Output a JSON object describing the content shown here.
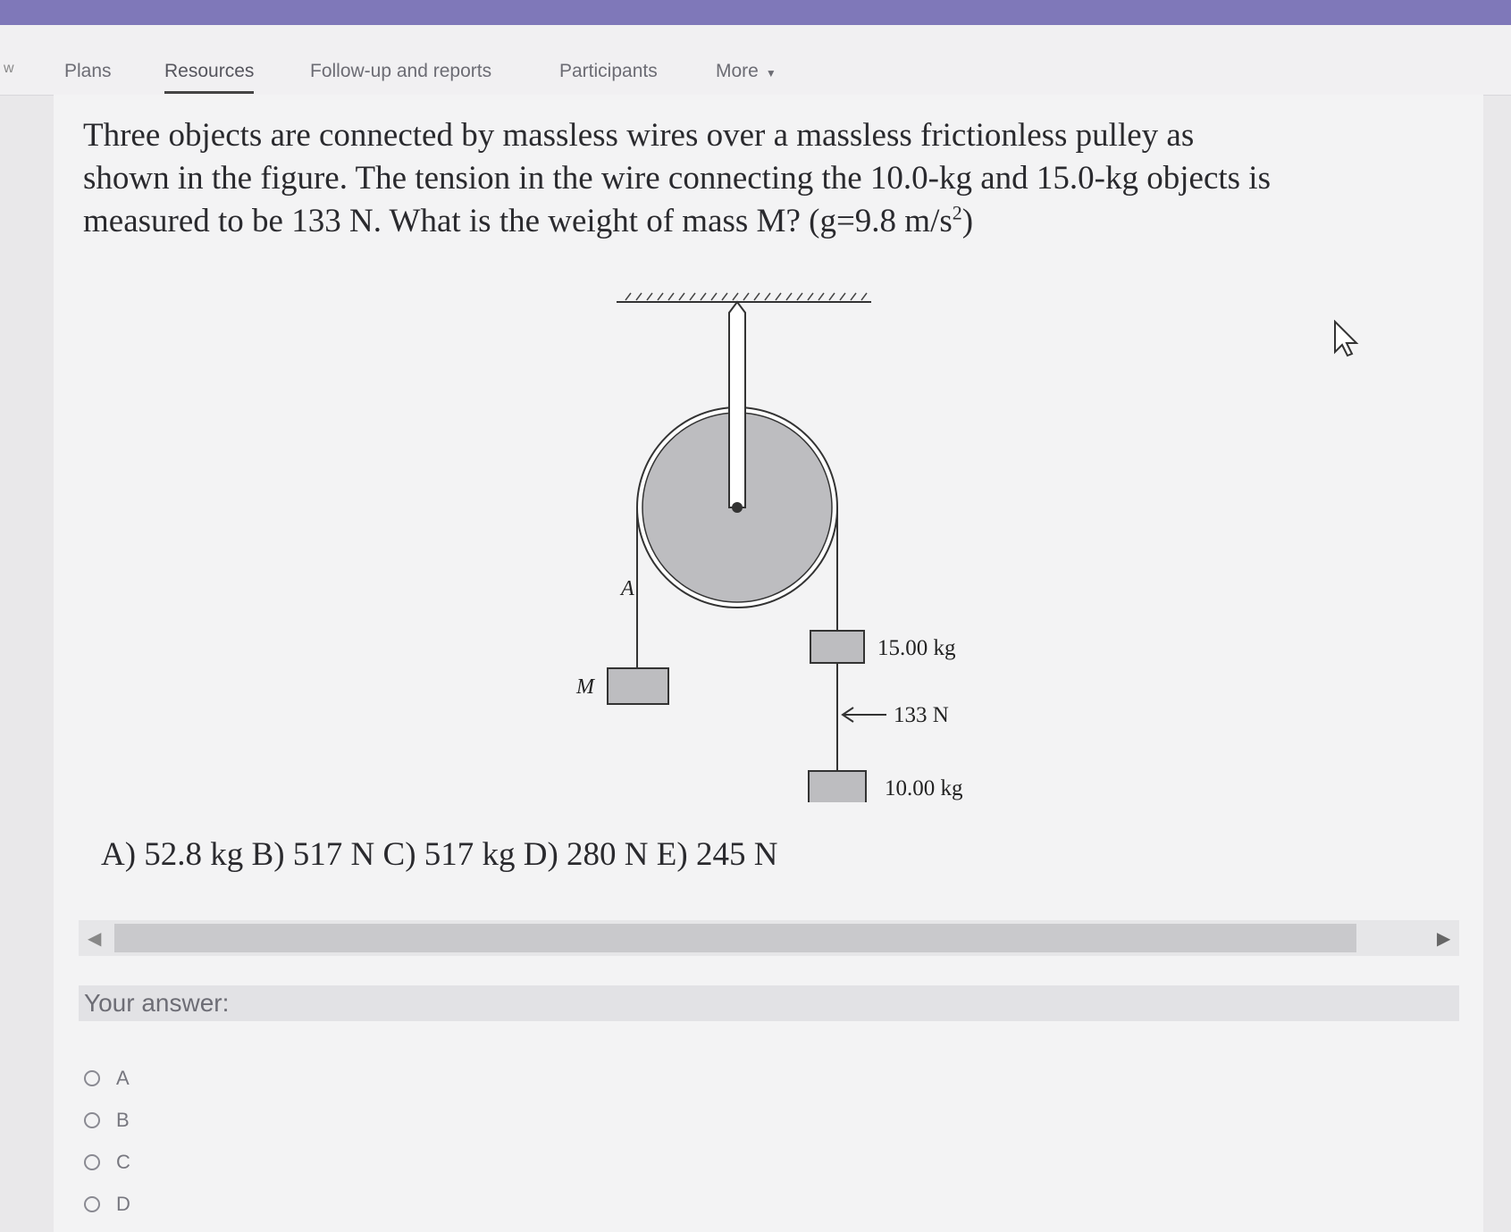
{
  "tabs": {
    "prev_partial": "w",
    "items": [
      {
        "label": "Plans"
      },
      {
        "label": "Resources"
      },
      {
        "label": "Follow-up and reports"
      },
      {
        "label": "Participants"
      },
      {
        "label": "More"
      }
    ],
    "active": "Resources"
  },
  "question": {
    "line1": "Three objects are connected by massless wires over a massless frictionless pulley as",
    "line2": "shown in the figure. The tension in the wire connecting the 10.0-kg and 15.0-kg objects is",
    "line3_before": "measured to be 133 N. What is the weight of mass M? (g=9.8 m/s",
    "line3_sup": "2",
    "line3_after": ")"
  },
  "figure": {
    "label_a": "A",
    "label_m": "M",
    "mass_upper": "15.00 kg",
    "tension": "133 N",
    "mass_lower": "10.00 kg"
  },
  "choices_text": "A) 52.8 kg  B) 517 N C) 517 kg D) 280 N E) 245 N",
  "answer": {
    "label": "Your answer:",
    "options": [
      "A",
      "B",
      "C",
      "D"
    ]
  },
  "colors": {
    "topbar": "#7f78b9",
    "pulley": "#bdbdc0"
  }
}
